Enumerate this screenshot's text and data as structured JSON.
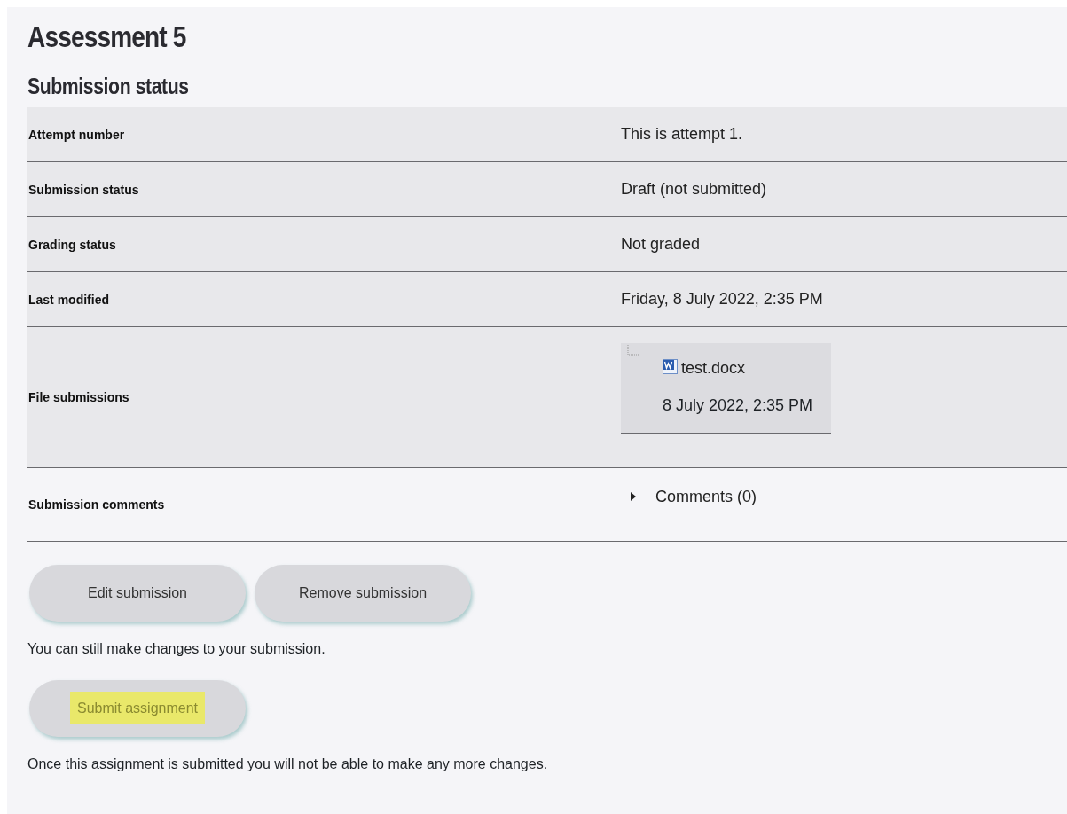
{
  "title": "Assessment 5",
  "section_title": "Submission status",
  "rows": [
    {
      "kind": "text",
      "label": "Attempt number",
      "value": "This is attempt 1."
    },
    {
      "kind": "text",
      "label": "Submission status",
      "value": "Draft (not submitted)"
    },
    {
      "kind": "text",
      "label": "Grading status",
      "value": "Not graded"
    },
    {
      "kind": "text",
      "label": "Last modified",
      "value": "Friday, 8 July 2022, 2:35 PM"
    },
    {
      "kind": "files",
      "label": "File submissions",
      "files": [
        {
          "name": "test.docx",
          "date": "8 July 2022, 2:35 PM"
        }
      ]
    },
    {
      "kind": "comments",
      "label": "Submission comments",
      "toggle": "Comments (0)",
      "expanded": false
    }
  ],
  "buttons": [
    {
      "label": "Edit submission",
      "highlighted": false
    },
    {
      "label": "Remove submission",
      "highlighted": false
    }
  ],
  "note": "You can still make changes to your submission.",
  "submit_button": {
    "label": "Submit assignment",
    "highlighted": true
  },
  "footer_note": "Once this assignment is submitted you will not be able to make any more changes."
}
